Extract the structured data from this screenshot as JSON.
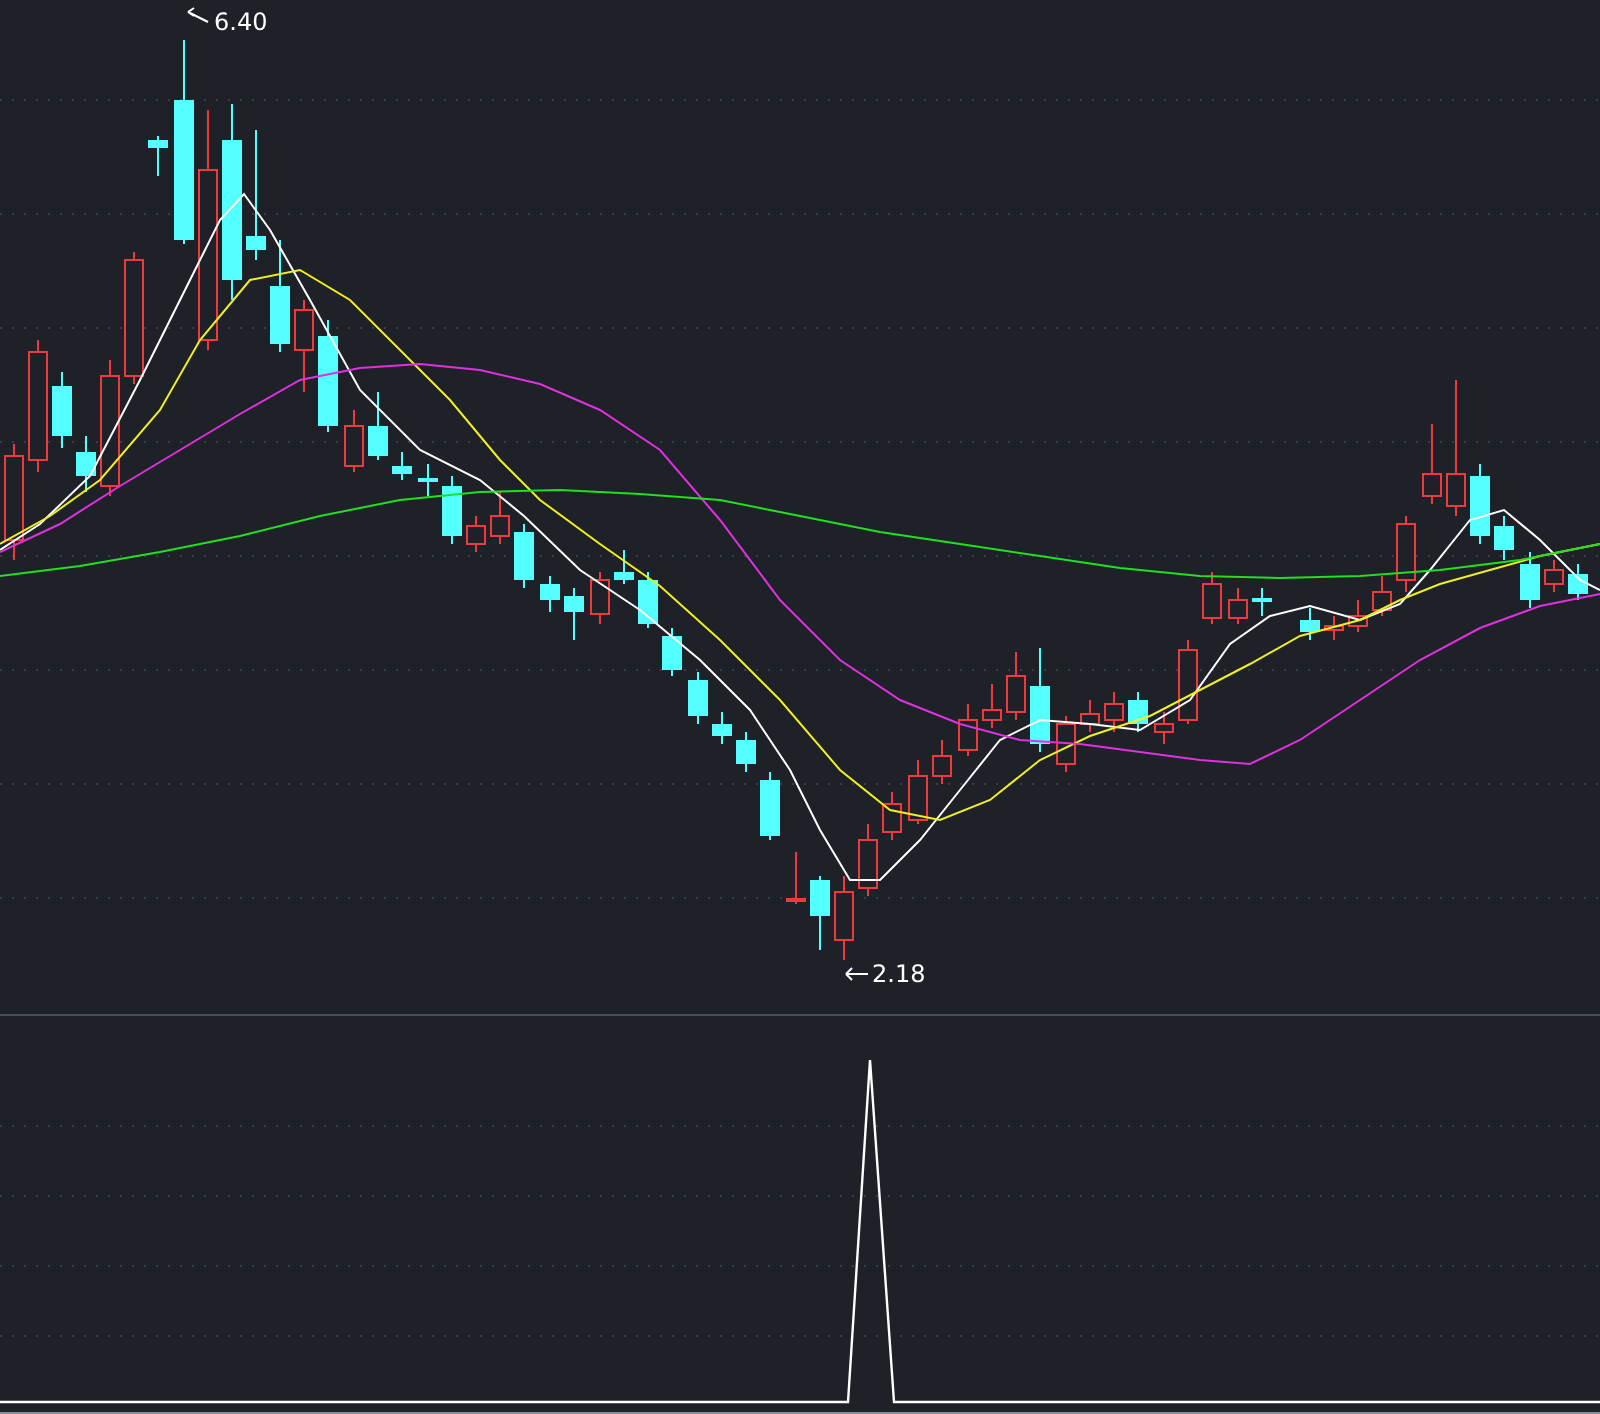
{
  "price_chart": {
    "high_label": "6.40",
    "low_label": "2.18"
  }
}
